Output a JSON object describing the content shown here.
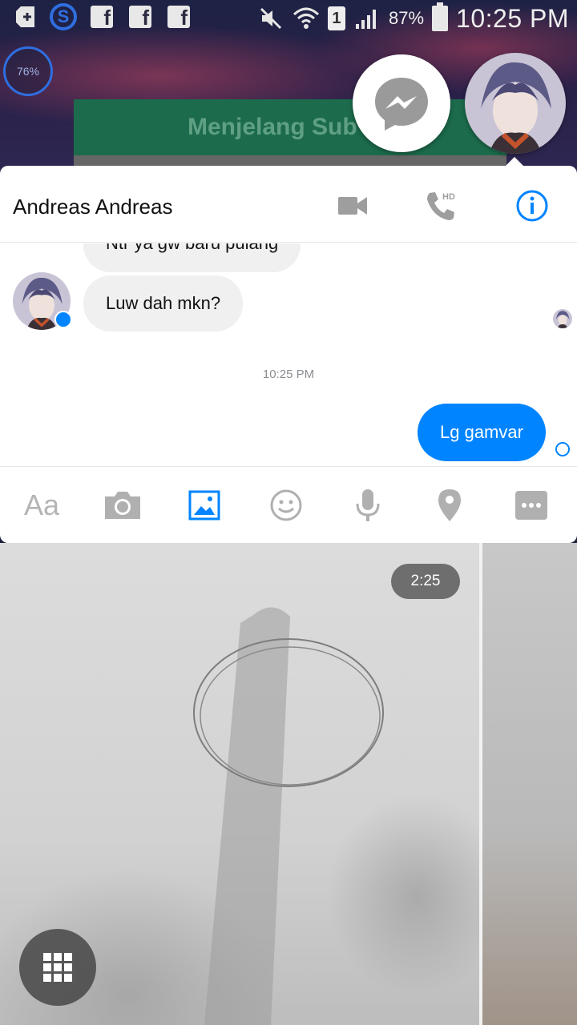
{
  "status_bar": {
    "time": "10:25 PM",
    "battery_percent": "87%",
    "sim_slot": "1",
    "icons": [
      "add-box-icon",
      "s-app-icon",
      "facebook-icon",
      "facebook-icon",
      "facebook-icon",
      "muted-icon",
      "wifi-icon",
      "signal-icon",
      "battery-icon"
    ]
  },
  "overlay": {
    "percent_circle": "76%",
    "banner_text": "Menjelang Sub"
  },
  "chat_heads": {
    "messenger_icon": "messenger-icon",
    "avatar_icon": "avatar-icon"
  },
  "conversation": {
    "contact_name": "Andreas Andreas",
    "header_icons": [
      "video-call-icon",
      "hd-phone-icon",
      "info-icon"
    ],
    "hd_label": "HD",
    "messages": [
      {
        "direction": "in",
        "text": "Ntr ya gw baru pulang"
      },
      {
        "direction": "in",
        "text": "Luw dah mkn?"
      },
      {
        "direction": "out",
        "text": "Lg gamvar"
      }
    ],
    "timestamp": "10:25 PM"
  },
  "composer": {
    "text_button": "Aa",
    "icons": [
      "camera-icon",
      "gallery-icon",
      "emoji-icon",
      "microphone-icon",
      "location-icon",
      "more-icon"
    ]
  },
  "media": {
    "video_duration": "2:25",
    "grid_icon": "grid-icon"
  },
  "colors": {
    "accent": "#0084ff",
    "bubble_in": "#f1f0f0",
    "icon_gray": "#b0b0b0"
  }
}
